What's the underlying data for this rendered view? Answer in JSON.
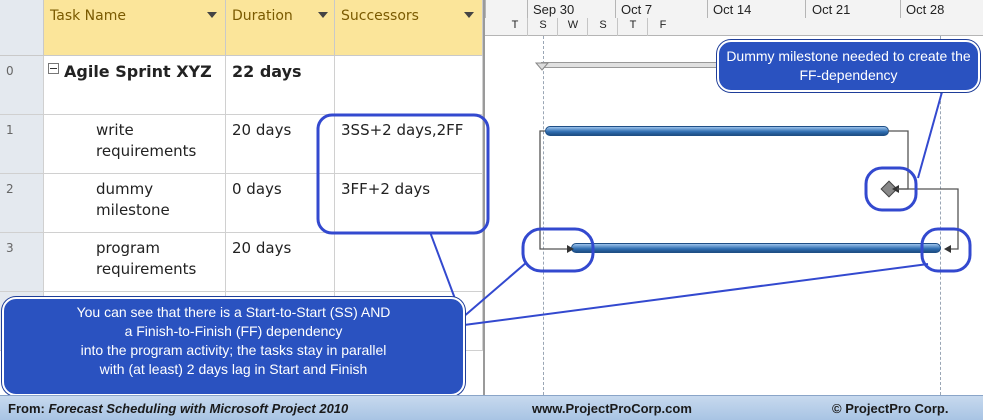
{
  "table": {
    "headers": {
      "id": "",
      "name": "Task Name",
      "duration": "Duration",
      "successors": "Successors"
    },
    "rows": [
      {
        "id": "0",
        "name": "Agile Sprint XYZ",
        "duration": "22 days",
        "successors": ""
      },
      {
        "id": "1",
        "name": "write requirements",
        "duration": "20 days",
        "successors": "3SS+2 days,2FF"
      },
      {
        "id": "2",
        "name": "dummy milestone",
        "duration": "0 days",
        "successors": "3FF+2 days"
      },
      {
        "id": "3",
        "name": "program requirements",
        "duration": "20 days",
        "successors": ""
      },
      {
        "id": "",
        "name": "",
        "duration": "",
        "successors": ""
      }
    ]
  },
  "gantt": {
    "weeks": [
      "Sep 30",
      "Oct 7",
      "Oct 14",
      "Oct 21",
      "Oct 28"
    ],
    "days": [
      "T",
      "S",
      "W",
      "S",
      "T",
      "F"
    ]
  },
  "callouts": {
    "top": "Dummy milestone needed to create the FF-dependency",
    "bottom_line1": "You can see that there is a Start-to-Start (SS) AND",
    "bottom_line2": "a Finish-to-Finish  (FF) dependency",
    "bottom_line3": "into the program activity; the tasks stay in parallel",
    "bottom_line4": "with (at least) 2 days lag in Start and Finish"
  },
  "footer": {
    "from_label": "From:",
    "from_title": "Forecast Scheduling with Microsoft Project 2010",
    "website": "www.ProjectProCorp.com",
    "copyright": "© ProjectPro Corp."
  },
  "colors": {
    "header": "#fbe59a",
    "bar": "#2e6db0",
    "callout": "#2a52c0",
    "footer": "#a8c4e4"
  }
}
